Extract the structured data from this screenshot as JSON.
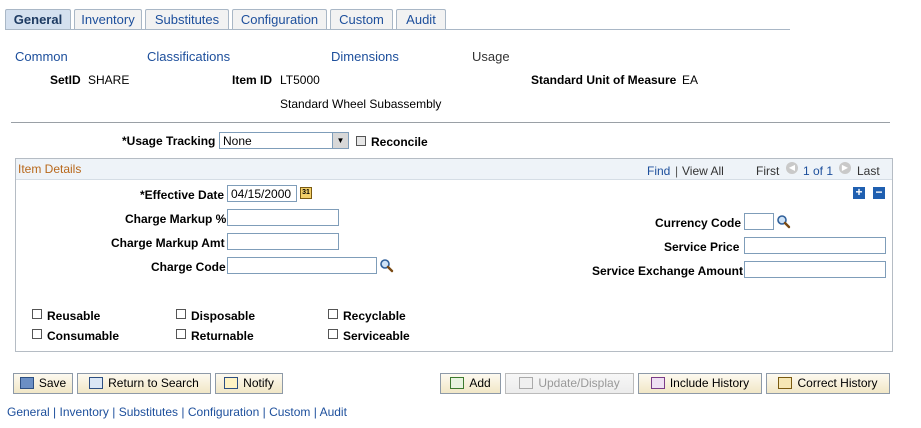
{
  "tabs": [
    {
      "label": "General",
      "active": true
    },
    {
      "label": "Inventory",
      "active": false
    },
    {
      "label": "Substitutes",
      "active": false
    },
    {
      "label": "Configuration",
      "active": false
    },
    {
      "label": "Custom",
      "active": false
    },
    {
      "label": "Audit",
      "active": false
    }
  ],
  "subnav": {
    "common": "Common",
    "classifications": "Classifications",
    "dimensions": "Dimensions",
    "usage": "Usage"
  },
  "header": {
    "setid_label": "SetID",
    "setid_value": "SHARE",
    "itemid_label": "Item ID",
    "itemid_value": "LT5000",
    "uom_label": "Standard Unit of Measure",
    "uom_value": "EA",
    "description": "Standard Wheel Subassembly"
  },
  "usage_tracking": {
    "label": "*Usage Tracking",
    "value": "None",
    "reconcile_label": "Reconcile"
  },
  "item_details": {
    "title": "Item Details",
    "find": "Find",
    "separator": "|",
    "view_all": "View All",
    "first": "First",
    "pager": "1 of 1",
    "last": "Last"
  },
  "fields": {
    "effective_date_label": "*Effective Date",
    "effective_date_value": "04/15/2000",
    "charge_markup_pct_label": "Charge Markup %",
    "charge_markup_pct_value": "",
    "charge_markup_amt_label": "Charge Markup Amt",
    "charge_markup_amt_value": "",
    "charge_code_label": "Charge Code",
    "charge_code_value": "",
    "currency_code_label": "Currency Code",
    "currency_code_value": "",
    "service_price_label": "Service Price",
    "service_price_value": "",
    "service_exchange_label": "Service Exchange Amount",
    "service_exchange_value": ""
  },
  "checkboxes": {
    "reusable": "Reusable",
    "disposable": "Disposable",
    "recyclable": "Recyclable",
    "consumable": "Consumable",
    "returnable": "Returnable",
    "serviceable": "Serviceable"
  },
  "buttons": {
    "save": "Save",
    "return_to_search": "Return to Search",
    "notify": "Notify",
    "add": "Add",
    "update_display": "Update/Display",
    "include_history": "Include History",
    "correct_history": "Correct History"
  },
  "footer_links": [
    "General",
    "Inventory",
    "Substitutes",
    "Configuration",
    "Custom",
    "Audit"
  ],
  "colors": {
    "link": "#1d4f9c",
    "section_title": "#b8681b",
    "tab_active": "#d4e0ef"
  }
}
